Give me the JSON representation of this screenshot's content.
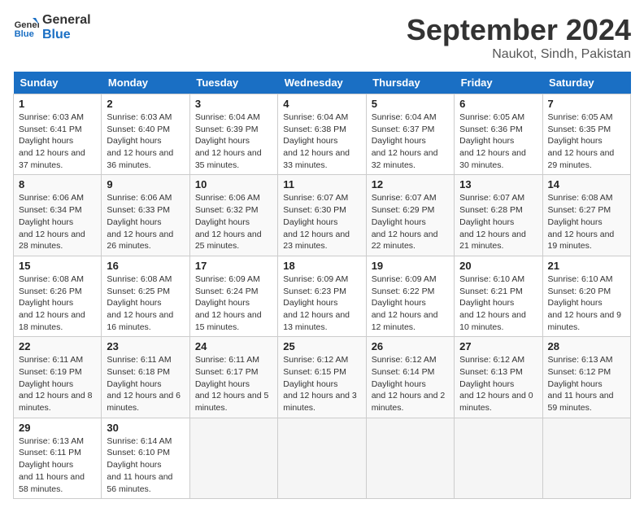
{
  "header": {
    "logo_line1": "General",
    "logo_line2": "Blue",
    "month": "September 2024",
    "location": "Naukot, Sindh, Pakistan"
  },
  "weekdays": [
    "Sunday",
    "Monday",
    "Tuesday",
    "Wednesday",
    "Thursday",
    "Friday",
    "Saturday"
  ],
  "weeks": [
    [
      {
        "day": "1",
        "sunrise": "6:03 AM",
        "sunset": "6:41 PM",
        "daylight": "12 hours and 37 minutes."
      },
      {
        "day": "2",
        "sunrise": "6:03 AM",
        "sunset": "6:40 PM",
        "daylight": "12 hours and 36 minutes."
      },
      {
        "day": "3",
        "sunrise": "6:04 AM",
        "sunset": "6:39 PM",
        "daylight": "12 hours and 35 minutes."
      },
      {
        "day": "4",
        "sunrise": "6:04 AM",
        "sunset": "6:38 PM",
        "daylight": "12 hours and 33 minutes."
      },
      {
        "day": "5",
        "sunrise": "6:04 AM",
        "sunset": "6:37 PM",
        "daylight": "12 hours and 32 minutes."
      },
      {
        "day": "6",
        "sunrise": "6:05 AM",
        "sunset": "6:36 PM",
        "daylight": "12 hours and 30 minutes."
      },
      {
        "day": "7",
        "sunrise": "6:05 AM",
        "sunset": "6:35 PM",
        "daylight": "12 hours and 29 minutes."
      }
    ],
    [
      {
        "day": "8",
        "sunrise": "6:06 AM",
        "sunset": "6:34 PM",
        "daylight": "12 hours and 28 minutes."
      },
      {
        "day": "9",
        "sunrise": "6:06 AM",
        "sunset": "6:33 PM",
        "daylight": "12 hours and 26 minutes."
      },
      {
        "day": "10",
        "sunrise": "6:06 AM",
        "sunset": "6:32 PM",
        "daylight": "12 hours and 25 minutes."
      },
      {
        "day": "11",
        "sunrise": "6:07 AM",
        "sunset": "6:30 PM",
        "daylight": "12 hours and 23 minutes."
      },
      {
        "day": "12",
        "sunrise": "6:07 AM",
        "sunset": "6:29 PM",
        "daylight": "12 hours and 22 minutes."
      },
      {
        "day": "13",
        "sunrise": "6:07 AM",
        "sunset": "6:28 PM",
        "daylight": "12 hours and 21 minutes."
      },
      {
        "day": "14",
        "sunrise": "6:08 AM",
        "sunset": "6:27 PM",
        "daylight": "12 hours and 19 minutes."
      }
    ],
    [
      {
        "day": "15",
        "sunrise": "6:08 AM",
        "sunset": "6:26 PM",
        "daylight": "12 hours and 18 minutes."
      },
      {
        "day": "16",
        "sunrise": "6:08 AM",
        "sunset": "6:25 PM",
        "daylight": "12 hours and 16 minutes."
      },
      {
        "day": "17",
        "sunrise": "6:09 AM",
        "sunset": "6:24 PM",
        "daylight": "12 hours and 15 minutes."
      },
      {
        "day": "18",
        "sunrise": "6:09 AM",
        "sunset": "6:23 PM",
        "daylight": "12 hours and 13 minutes."
      },
      {
        "day": "19",
        "sunrise": "6:09 AM",
        "sunset": "6:22 PM",
        "daylight": "12 hours and 12 minutes."
      },
      {
        "day": "20",
        "sunrise": "6:10 AM",
        "sunset": "6:21 PM",
        "daylight": "12 hours and 10 minutes."
      },
      {
        "day": "21",
        "sunrise": "6:10 AM",
        "sunset": "6:20 PM",
        "daylight": "12 hours and 9 minutes."
      }
    ],
    [
      {
        "day": "22",
        "sunrise": "6:11 AM",
        "sunset": "6:19 PM",
        "daylight": "12 hours and 8 minutes."
      },
      {
        "day": "23",
        "sunrise": "6:11 AM",
        "sunset": "6:18 PM",
        "daylight": "12 hours and 6 minutes."
      },
      {
        "day": "24",
        "sunrise": "6:11 AM",
        "sunset": "6:17 PM",
        "daylight": "12 hours and 5 minutes."
      },
      {
        "day": "25",
        "sunrise": "6:12 AM",
        "sunset": "6:15 PM",
        "daylight": "12 hours and 3 minutes."
      },
      {
        "day": "26",
        "sunrise": "6:12 AM",
        "sunset": "6:14 PM",
        "daylight": "12 hours and 2 minutes."
      },
      {
        "day": "27",
        "sunrise": "6:12 AM",
        "sunset": "6:13 PM",
        "daylight": "12 hours and 0 minutes."
      },
      {
        "day": "28",
        "sunrise": "6:13 AM",
        "sunset": "6:12 PM",
        "daylight": "11 hours and 59 minutes."
      }
    ],
    [
      {
        "day": "29",
        "sunrise": "6:13 AM",
        "sunset": "6:11 PM",
        "daylight": "11 hours and 58 minutes."
      },
      {
        "day": "30",
        "sunrise": "6:14 AM",
        "sunset": "6:10 PM",
        "daylight": "11 hours and 56 minutes."
      },
      null,
      null,
      null,
      null,
      null
    ]
  ]
}
